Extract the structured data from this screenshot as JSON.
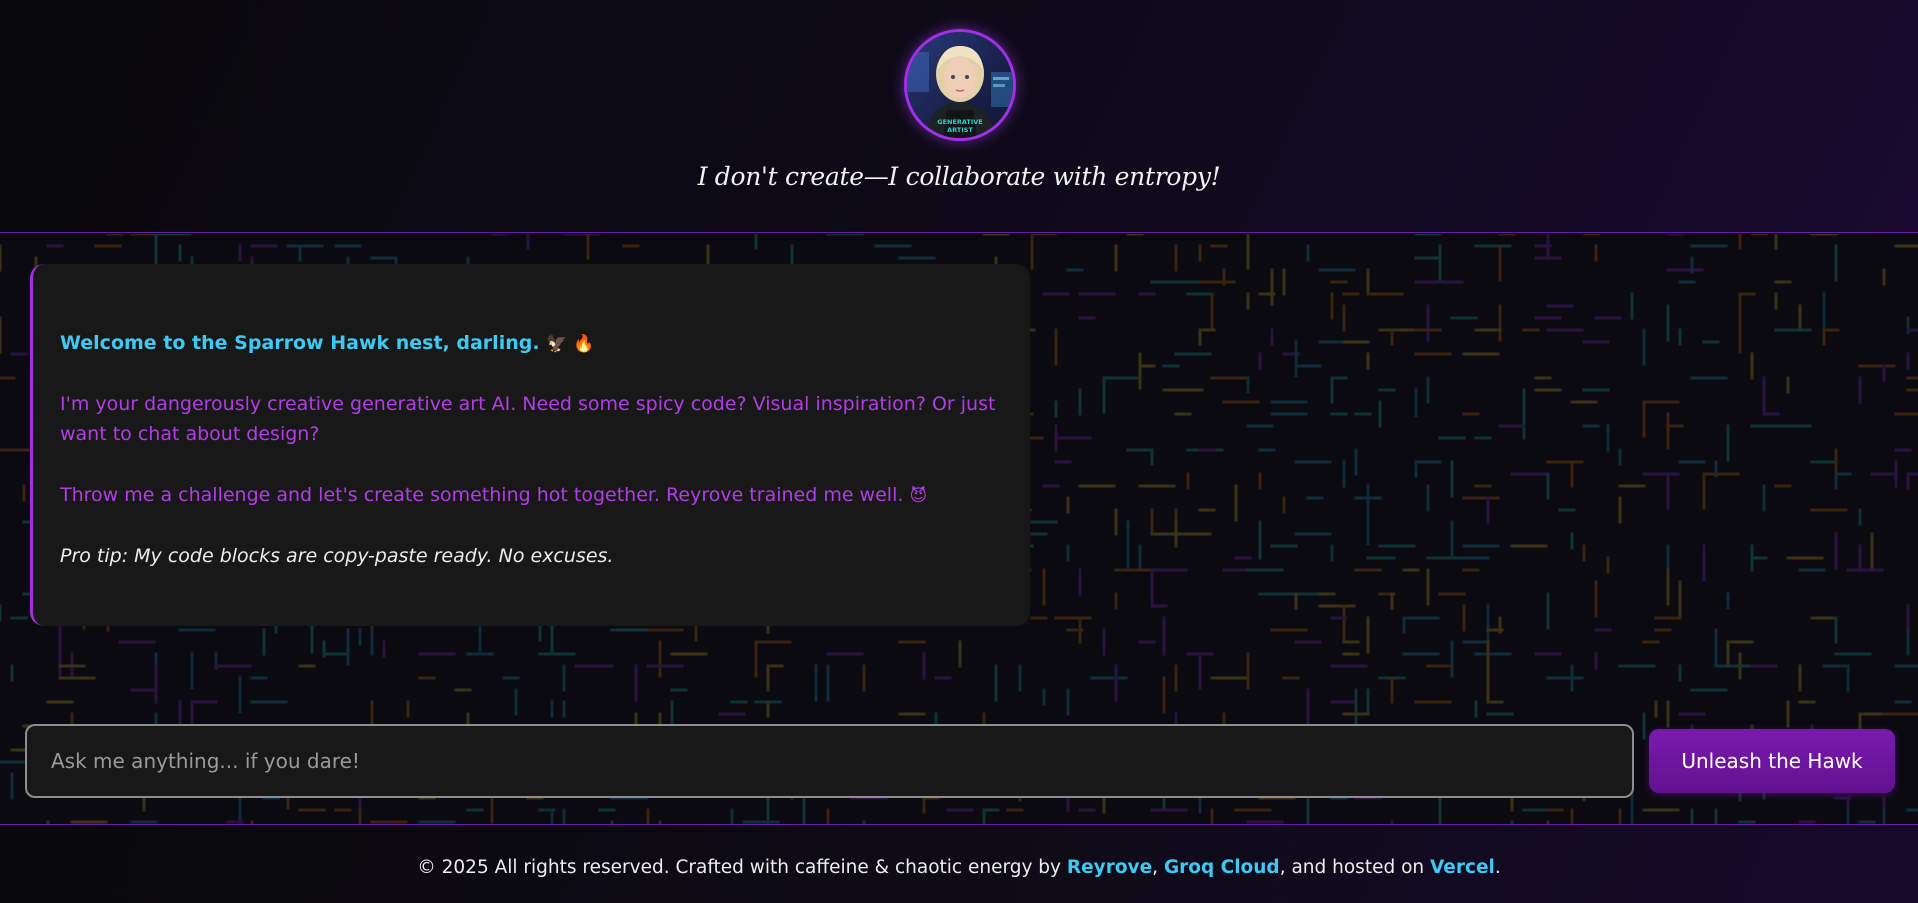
{
  "header": {
    "avatar_shirt_text": "GENERATIVE ARTIST",
    "tagline": "I don't create—I collaborate with entropy!"
  },
  "chat": {
    "messages": [
      {
        "role": "assistant",
        "welcome": "Welcome to the Sparrow Hawk nest, darling.",
        "welcome_emojis": "🦅 🔥",
        "intro": "I'm your dangerously creative generative art AI. Need some spicy code? Visual inspiration? Or just want to chat about design?",
        "challenge": "Throw me a challenge and let's create something hot together. Reyrove trained me well.",
        "challenge_emoji": "😈",
        "tip": "Pro tip: My code blocks are copy-paste ready. No excuses."
      }
    ]
  },
  "composer": {
    "placeholder": "Ask me anything... if you dare!",
    "send_label": "Unleash the Hawk"
  },
  "footer": {
    "prefix": "© 2025 All rights reserved. Crafted with caffeine & chaotic energy by ",
    "link_reyrove": "Reyrove",
    "sep1": ", ",
    "link_groq": "Groq Cloud",
    "sep2": ", and hosted on ",
    "link_vercel": "Vercel",
    "suffix": "."
  },
  "colors": {
    "accent_purple": "#a22ee0",
    "accent_cyan": "#3fc8f2",
    "message_purple": "#b23de6",
    "button_purple": "#6e169e"
  }
}
